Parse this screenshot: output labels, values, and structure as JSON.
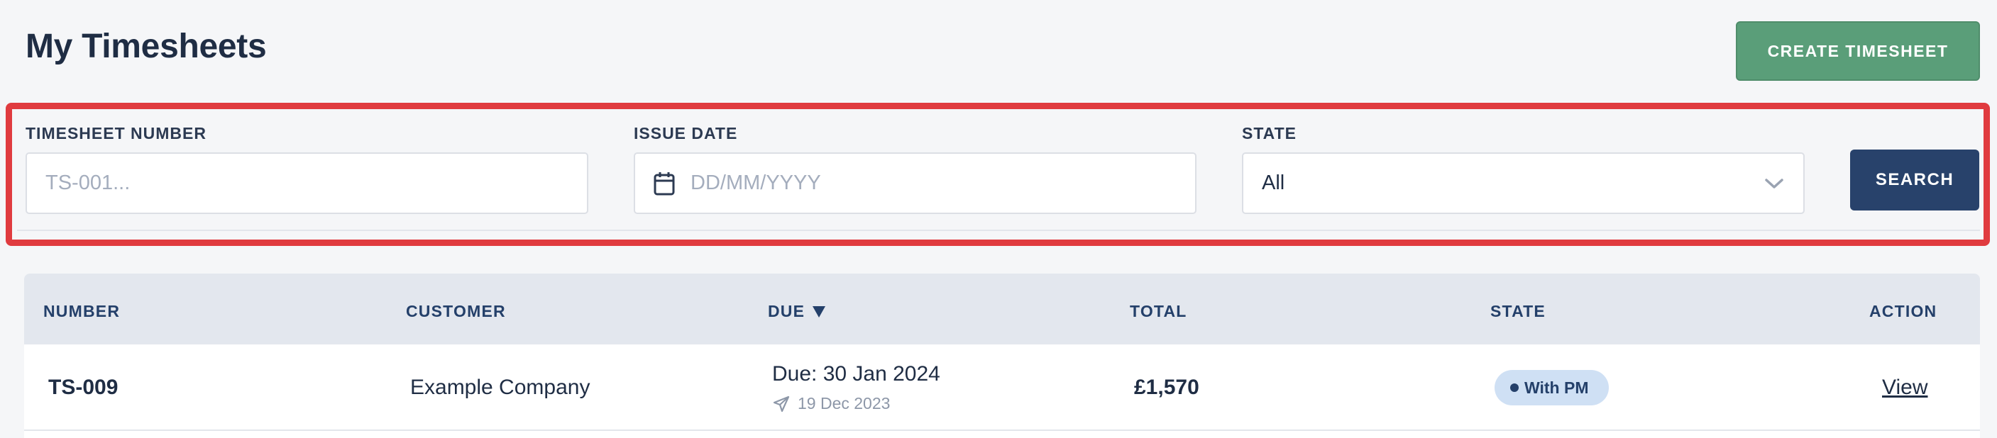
{
  "header": {
    "title": "My Timesheets",
    "create_button_label": "CREATE TIMESHEET"
  },
  "filters": {
    "timesheet_number": {
      "label": "TIMESHEET NUMBER",
      "placeholder": "TS-001...",
      "value": ""
    },
    "issue_date": {
      "label": "ISSUE DATE",
      "placeholder": "DD/MM/YYYY",
      "value": "",
      "icon": "calendar-icon"
    },
    "state": {
      "label": "STATE",
      "selected": "All",
      "icon": "chevron-down-icon"
    },
    "search_button_label": "SEARCH"
  },
  "table": {
    "columns": [
      "NUMBER",
      "CUSTOMER",
      "DUE",
      "TOTAL",
      "STATE",
      "ACTION"
    ],
    "sort_column": "DUE",
    "sort_direction": "descending",
    "rows": [
      {
        "number": "TS-009",
        "customer": "Example Company",
        "due": "Due: 30 Jan 2024",
        "sent": "19 Dec 2023",
        "total": "£1,570",
        "state": "With PM",
        "action": "View"
      }
    ]
  },
  "colors": {
    "create_button": "#5a9e79",
    "search_button": "#28426b",
    "highlight_border": "#e03b3f",
    "badge_bg": "#cfe0f4",
    "table_header_bg": "#e3e7ee"
  }
}
